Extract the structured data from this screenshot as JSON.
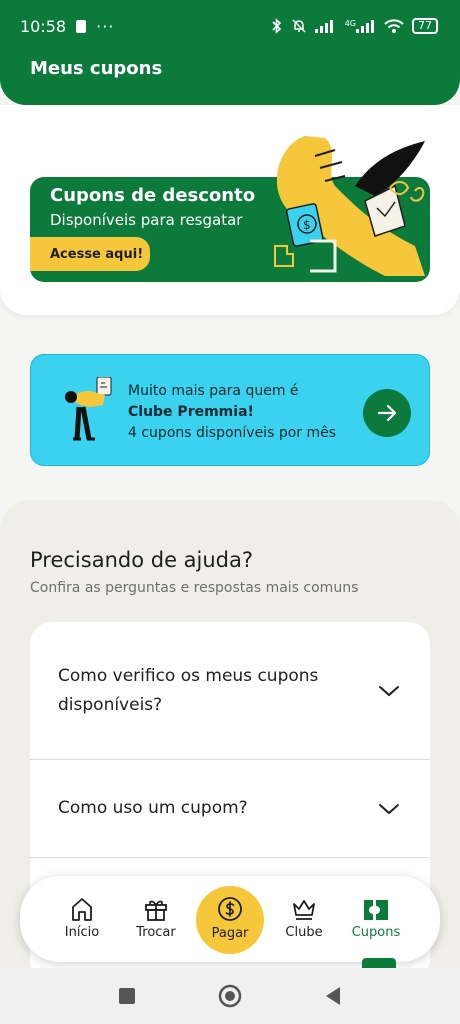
{
  "status_bar": {
    "time": "10:58",
    "more": "···",
    "network_label": "4G",
    "battery": "77"
  },
  "header": {
    "title": "Meus cupons"
  },
  "hero": {
    "title": "Cupons de desconto",
    "subtitle": "Disponíveis para resgatar",
    "button_label": "Acesse aqui!"
  },
  "premmia": {
    "line1": "Muito mais para quem é",
    "line2": "Clube Premmia!",
    "line3": "4 cupons disponíveis por mês"
  },
  "help": {
    "title": "Precisando de ajuda?",
    "subtitle": "Confira as perguntas e respostas mais comuns",
    "faq": [
      {
        "question": "Como verifico os meus cupons disponíveis?"
      },
      {
        "question": "Como uso um cupom?"
      }
    ]
  },
  "nav": {
    "items": [
      {
        "label": "Início",
        "icon": "home-icon"
      },
      {
        "label": "Trocar",
        "icon": "gift-icon"
      },
      {
        "label": "Pagar",
        "icon": "dollar-coin-icon"
      },
      {
        "label": "Clube",
        "icon": "crown-icon"
      },
      {
        "label": "Cupons",
        "icon": "coupon-icon"
      }
    ],
    "active": "Cupons"
  },
  "colors": {
    "brand_green": "#0c7a3a",
    "accent_yellow": "#f6c73b",
    "premmia_cyan": "#3ad2ee"
  }
}
